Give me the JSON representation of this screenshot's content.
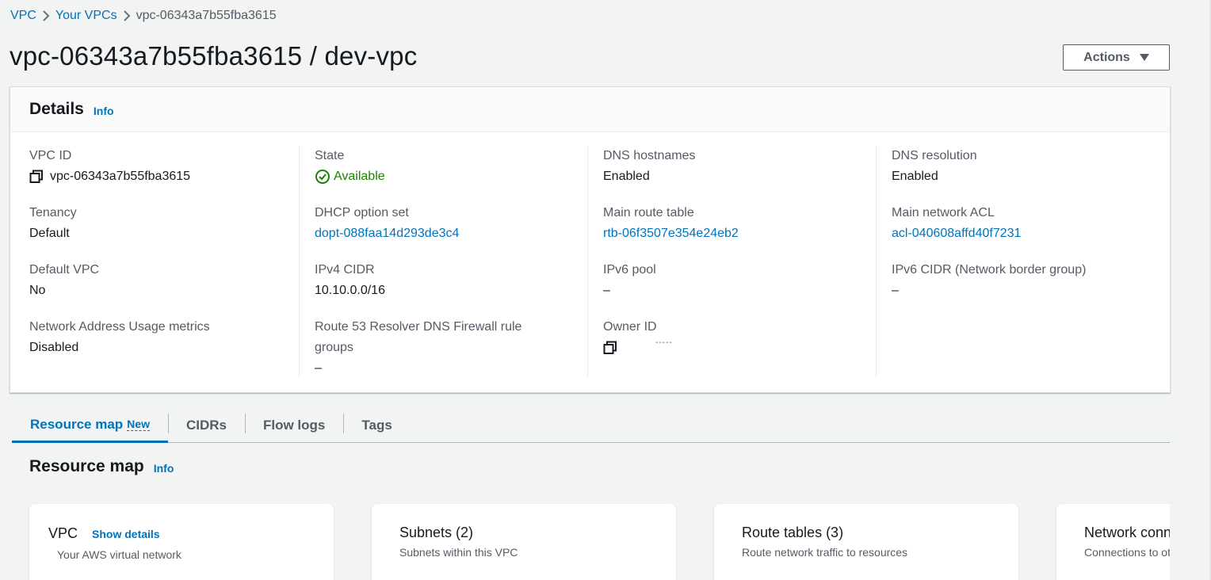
{
  "breadcrumb": {
    "items": [
      "VPC",
      "Your VPCs"
    ],
    "current": "vpc-06343a7b55fba3615"
  },
  "header": {
    "title": "vpc-06343a7b55fba3615 / dev-vpc",
    "actions_label": "Actions"
  },
  "details": {
    "title": "Details",
    "info": "Info",
    "columns": [
      [
        {
          "label": "VPC ID",
          "value": "vpc-06343a7b55fba3615"
        },
        {
          "label": "Tenancy",
          "value": "Default"
        },
        {
          "label": "Default VPC",
          "value": "No"
        },
        {
          "label": "Network Address Usage metrics",
          "value": "Disabled"
        }
      ],
      [
        {
          "label": "State",
          "value": "Available"
        },
        {
          "label": "DHCP option set",
          "value": "dopt-088faa14d293de3c4"
        },
        {
          "label": "IPv4 CIDR",
          "value": "10.10.0.0/16"
        },
        {
          "label_line1": "Route 53 Resolver DNS Firewall rule",
          "label_line2": "groups",
          "value": "–"
        }
      ],
      [
        {
          "label": "DNS hostnames",
          "value": "Enabled"
        },
        {
          "label": "Main route table",
          "value": "rtb-06f3507e354e24eb2"
        },
        {
          "label": "IPv6 pool",
          "value": "–"
        },
        {
          "label": "Owner ID",
          "value": "-----"
        }
      ],
      [
        {
          "label": "DNS resolution",
          "value": "Enabled"
        },
        {
          "label": "Main network ACL",
          "value": "acl-040608affd40f7231"
        },
        {
          "label": "IPv6 CIDR (Network border group)",
          "value": "–"
        }
      ]
    ]
  },
  "tabs": [
    {
      "label": "Resource map",
      "badge": "New",
      "active": true
    },
    {
      "label": "CIDRs"
    },
    {
      "label": "Flow logs"
    },
    {
      "label": "Tags"
    }
  ],
  "resource_map": {
    "title": "Resource map",
    "info": "Info",
    "cards": [
      {
        "title": "VPC",
        "action": "Show details",
        "subtitle": "Your AWS virtual network"
      },
      {
        "title": "Subnets (2)",
        "subtitle": "Subnets within this VPC"
      },
      {
        "title": "Route tables (3)",
        "subtitle": "Route network traffic to resources"
      },
      {
        "title": "Network connections",
        "subtitle": "Connections to other networks"
      }
    ]
  },
  "colors": {
    "link": "#0073bb",
    "success": "#1d8102",
    "text": "#16191f",
    "muted": "#545b64",
    "background": "#f2f3f3"
  },
  "icons": [
    "chevron-right-icon",
    "copy-icon",
    "status-check-icon",
    "caret-down-icon"
  ]
}
